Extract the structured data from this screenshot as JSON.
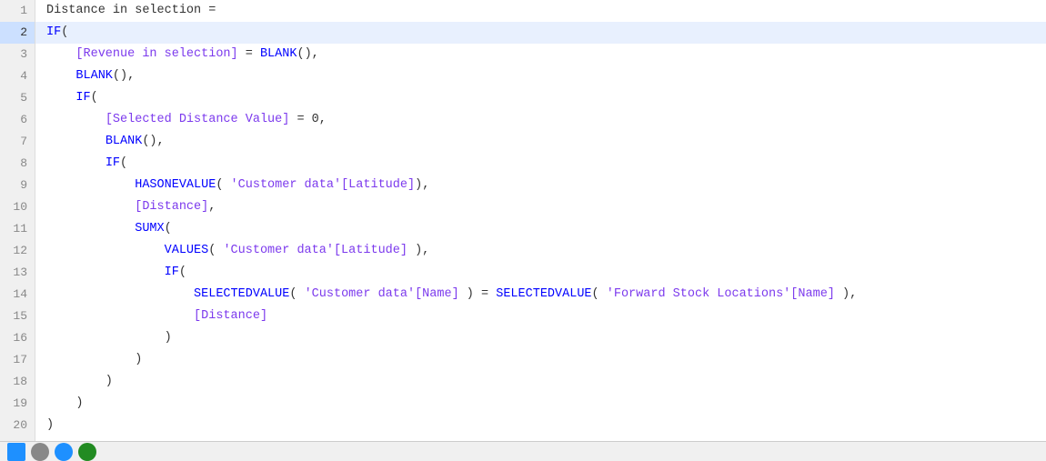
{
  "editor": {
    "lines": [
      {
        "num": 1,
        "active": false,
        "tokens": [
          {
            "type": "plain",
            "text": "Distance in selection ="
          }
        ]
      },
      {
        "num": 2,
        "active": true,
        "tokens": [
          {
            "type": "kw",
            "text": "IF"
          },
          {
            "type": "plain",
            "text": "("
          }
        ]
      },
      {
        "num": 3,
        "active": false,
        "tokens": [
          {
            "type": "plain",
            "text": "    "
          },
          {
            "type": "field",
            "text": "[Revenue in selection]"
          },
          {
            "type": "plain",
            "text": " = "
          },
          {
            "type": "kw",
            "text": "BLANK"
          },
          {
            "type": "plain",
            "text": "(),"
          }
        ]
      },
      {
        "num": 4,
        "active": false,
        "tokens": [
          {
            "type": "plain",
            "text": "    "
          },
          {
            "type": "kw",
            "text": "BLANK"
          },
          {
            "type": "plain",
            "text": "(),"
          }
        ]
      },
      {
        "num": 5,
        "active": false,
        "tokens": [
          {
            "type": "plain",
            "text": "    "
          },
          {
            "type": "kw",
            "text": "IF"
          },
          {
            "type": "plain",
            "text": "("
          }
        ]
      },
      {
        "num": 6,
        "active": false,
        "tokens": [
          {
            "type": "plain",
            "text": "        "
          },
          {
            "type": "field",
            "text": "[Selected Distance Value]"
          },
          {
            "type": "plain",
            "text": " = 0,"
          }
        ]
      },
      {
        "num": 7,
        "active": false,
        "tokens": [
          {
            "type": "plain",
            "text": "        "
          },
          {
            "type": "kw",
            "text": "BLANK"
          },
          {
            "type": "plain",
            "text": "(),"
          }
        ]
      },
      {
        "num": 8,
        "active": false,
        "tokens": [
          {
            "type": "plain",
            "text": "        "
          },
          {
            "type": "kw",
            "text": "IF"
          },
          {
            "type": "plain",
            "text": "("
          }
        ]
      },
      {
        "num": 9,
        "active": false,
        "tokens": [
          {
            "type": "plain",
            "text": "            "
          },
          {
            "type": "kw",
            "text": "HASONEVALUE"
          },
          {
            "type": "plain",
            "text": "( "
          },
          {
            "type": "field",
            "text": "'Customer data'[Latitude]"
          },
          {
            "type": "plain",
            "text": "),"
          }
        ]
      },
      {
        "num": 10,
        "active": false,
        "tokens": [
          {
            "type": "plain",
            "text": "            "
          },
          {
            "type": "field",
            "text": "[Distance]"
          },
          {
            "type": "plain",
            "text": ","
          }
        ]
      },
      {
        "num": 11,
        "active": false,
        "tokens": [
          {
            "type": "plain",
            "text": "            "
          },
          {
            "type": "kw",
            "text": "SUMX"
          },
          {
            "type": "plain",
            "text": "("
          }
        ]
      },
      {
        "num": 12,
        "active": false,
        "tokens": [
          {
            "type": "plain",
            "text": "                "
          },
          {
            "type": "kw",
            "text": "VALUES"
          },
          {
            "type": "plain",
            "text": "( "
          },
          {
            "type": "field",
            "text": "'Customer data'[Latitude]"
          },
          {
            "type": "plain",
            "text": " ),"
          }
        ]
      },
      {
        "num": 13,
        "active": false,
        "tokens": [
          {
            "type": "plain",
            "text": "                "
          },
          {
            "type": "kw",
            "text": "IF"
          },
          {
            "type": "plain",
            "text": "("
          }
        ]
      },
      {
        "num": 14,
        "active": false,
        "tokens": [
          {
            "type": "plain",
            "text": "                    "
          },
          {
            "type": "kw",
            "text": "SELECTEDVALUE"
          },
          {
            "type": "plain",
            "text": "( "
          },
          {
            "type": "field",
            "text": "'Customer data'[Name]"
          },
          {
            "type": "plain",
            "text": " ) = "
          },
          {
            "type": "kw",
            "text": "SELECTEDVALUE"
          },
          {
            "type": "plain",
            "text": "( "
          },
          {
            "type": "field",
            "text": "'Forward Stock Locations'[Name]"
          },
          {
            "type": "plain",
            "text": " ),"
          }
        ]
      },
      {
        "num": 15,
        "active": false,
        "tokens": [
          {
            "type": "plain",
            "text": "                    "
          },
          {
            "type": "field",
            "text": "[Distance]"
          }
        ]
      },
      {
        "num": 16,
        "active": false,
        "tokens": [
          {
            "type": "plain",
            "text": "                )"
          }
        ]
      },
      {
        "num": 17,
        "active": false,
        "tokens": [
          {
            "type": "plain",
            "text": "            )"
          }
        ]
      },
      {
        "num": 18,
        "active": false,
        "tokens": [
          {
            "type": "plain",
            "text": "        )"
          }
        ]
      },
      {
        "num": 19,
        "active": false,
        "tokens": [
          {
            "type": "plain",
            "text": "    )"
          }
        ]
      },
      {
        "num": 20,
        "active": false,
        "tokens": [
          {
            "type": "plain",
            "text": ")"
          }
        ]
      }
    ]
  }
}
